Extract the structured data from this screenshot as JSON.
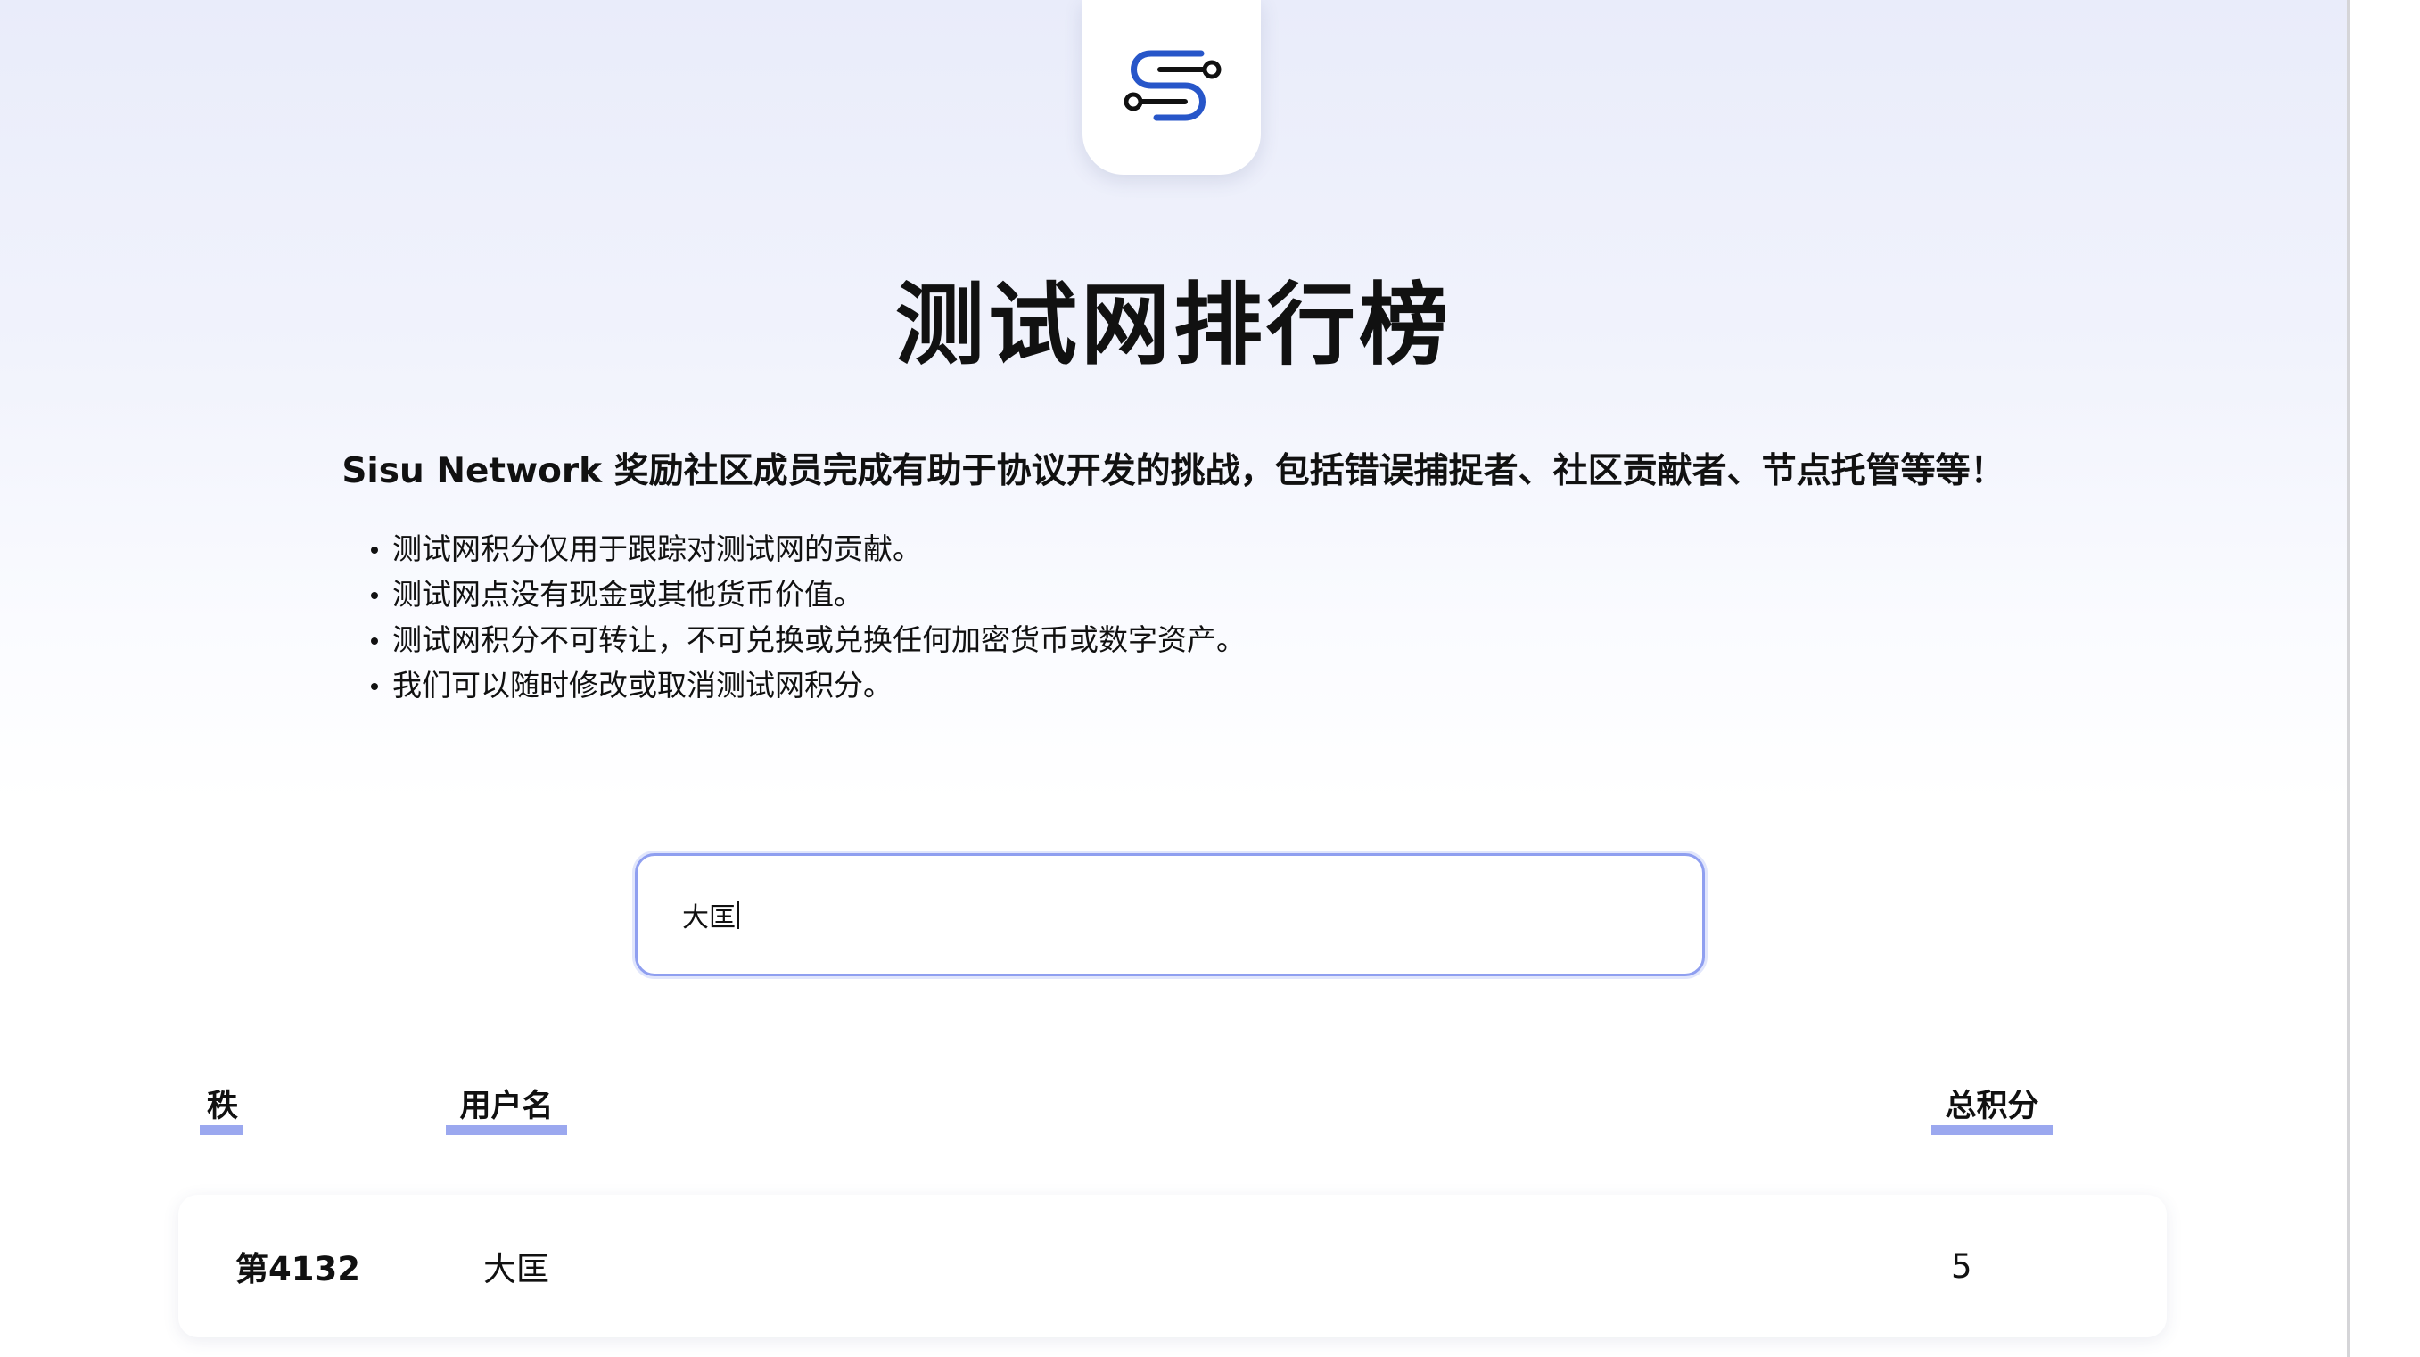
{
  "logo": {
    "icon": "sisu-logo-icon",
    "color": "#2756c9"
  },
  "title": "测试网排行榜",
  "intro": "Sisu Network 奖励社区成员完成有助于协议开发的挑战，包括错误捕捉者、社区贡献者、节点托管等等！",
  "bullets": [
    "测试网积分仅用于跟踪对测试网的贡献。",
    "测试网点没有现金或其他货币价值。",
    "测试网积分不可转让，不可兑换或兑换任何加密货币或数字资产。",
    "我们可以随时修改或取消测试网积分。"
  ],
  "search": {
    "value": "大匡"
  },
  "table": {
    "headers": {
      "rank": "秩",
      "username": "用户名",
      "points": "总积分"
    },
    "rows": [
      {
        "rank": "第4132",
        "username": "大匡",
        "points": "5"
      }
    ]
  },
  "colors": {
    "accent": "#9ba8ef",
    "input_border": "#8f9ff0"
  }
}
